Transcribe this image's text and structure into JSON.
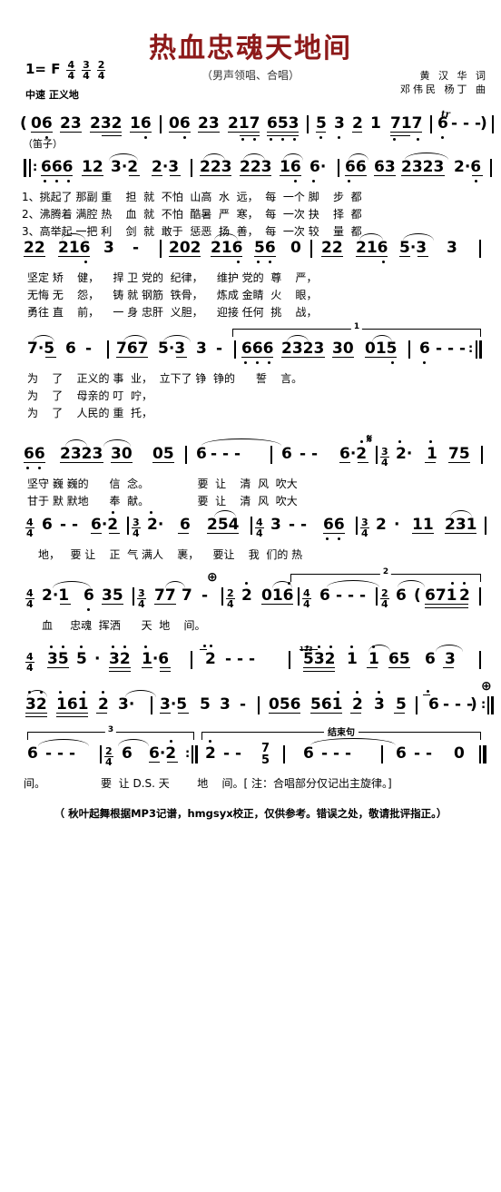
{
  "header": {
    "title": "热血忠魂天地间",
    "subtitle": "（男声领唱、合唱）",
    "key_label": "1= F",
    "meters": [
      {
        "num": "4",
        "den": "4"
      },
      {
        "num": "3",
        "den": "4"
      },
      {
        "num": "2",
        "den": "4"
      }
    ],
    "tempo": "中速 正义地",
    "lyricist": "黄 汉 华 词",
    "composer": "邓伟民 杨丁 曲"
  },
  "intro": {
    "instrument": "（笛子）",
    "notes": "( 06 23 232 16 | 06 23 217 653 | 5 3 2 1 717 | 6 - - - ) |"
  },
  "systems": [
    {
      "id": "system-1",
      "notes": "‖: 666 12 3·2 2·3 | 223 223 16 6· | 66 63 2323 2·6 |",
      "lyrics": [
        "1、挑起了 那副 重    担  就  不怕  山高  水  远，  每  一个 脚    步  都",
        "2、沸腾着 满腔 热    血  就  不怕  酷暑  严  寒，  每  一次 抉    择  都",
        "3、高举起 一把 利    剑  就  敢于  惩恶  扬  善，  每  一次 较    量  都"
      ]
    },
    {
      "id": "system-2",
      "notes": "22 216 3 - | 202 216 56 0 | 22 216 5·3 3 |",
      "lyrics": [
        "坚定 矫    健，    捍 卫 党的  纪律，    维护 党的  尊    严，",
        "无悔 无    怨，    铸 就 钢筋  铁骨，    炼成 金睛  火    眼，",
        "勇往 直    前，    一 身 忠肝  义胆，    迎接 任何  挑    战，"
      ]
    },
    {
      "id": "system-3",
      "notes": "7·5 6 - | 767 5·3 3 - | 666 2323 30 015 | 6 - - - :‖",
      "ending_label": "1",
      "lyrics": [
        "为    了    正义的 事  业，  立下了 铮  铮的      誓    言。",
        "为    了    母亲的 叮  咛，",
        "为    了    人民的 重  托，"
      ]
    },
    {
      "id": "system-4",
      "notes": "66 2323 30 05 | 6 - - - | 6 - - 6·2 | 3/4 2· 1 75 |",
      "segno": "𝄋",
      "lyrics": [
        "坚守 巍 巍的      信  念。              要  让    清  风  吹大",
        "甘于 默 默地      奉  献。              要  让    清  风  吹大"
      ]
    },
    {
      "id": "system-5",
      "notes": "4/4 6 - - 6·2 | 3/4 2· 6 254 | 4/4 3 - - 66 | 3/4 2 · 11 231 |",
      "lyrics": [
        "地，   要 让    正  气 满人    裹，    要让    我  们的 热"
      ]
    },
    {
      "id": "system-6",
      "notes": "4/4 2·1 6 35 | 3/4 77 7 - | 2/4 2 016 | 4/4 6 - - - | 2/4 6 (671 2 |",
      "coda": "⊕",
      "ending_label": "2",
      "lyrics": [
        "血     忠魂  挥洒      天  地    间。"
      ]
    },
    {
      "id": "system-7",
      "notes": "4/4 35 5 · 32 1·6 | 2 - - - | 532 1 1 65 6 3 |",
      "lyrics": []
    },
    {
      "id": "system-8",
      "notes": "32 161 2 3· | 3·5 5 3 - | 056 561 2 3 5 | 6 - - - ) :‖",
      "coda": "⊕",
      "lyrics": []
    },
    {
      "id": "system-9",
      "notes": "6 - - - | 2/4 6 6·2 :‖ 2 - - 7/5 | 6 - - - | 6 - - 0 ‖",
      "ending_label": "3",
      "coda_label": "结束句",
      "lyrics": [
        "间。                要  让 D.S. 天        地    间。[ 注：合唱部分仅记出主旋律。]"
      ]
    }
  ],
  "footnote": "（ 秋叶起舞根据MP3记谱，hmgsyx校正，仅供参考。错误之处，敬请批评指正。）",
  "colors": {
    "title": "#8d1a1a",
    "ink": "#000000",
    "paper": "#ffffff"
  }
}
